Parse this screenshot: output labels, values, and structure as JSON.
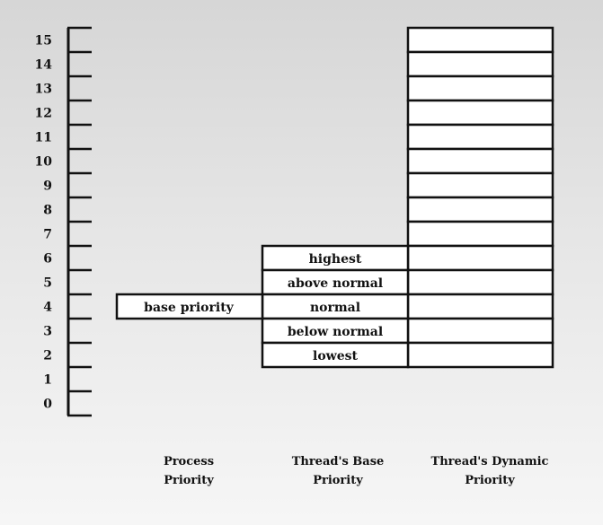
{
  "scale": {
    "levels": [
      "0",
      "1",
      "2",
      "3",
      "4",
      "5",
      "6",
      "7",
      "8",
      "9",
      "10",
      "11",
      "12",
      "13",
      "14",
      "15"
    ]
  },
  "process_priority": {
    "label": "base priority",
    "level": 4
  },
  "thread_base_priority": {
    "rows": [
      {
        "label": "highest",
        "level": 6
      },
      {
        "label": "above normal",
        "level": 5
      },
      {
        "label": "normal",
        "level": 4
      },
      {
        "label": "below normal",
        "level": 3
      },
      {
        "label": "lowest",
        "level": 2
      }
    ]
  },
  "thread_dynamic_priority": {
    "min_level": 2,
    "max_level": 15
  },
  "captions": [
    {
      "line1": "Process",
      "line2": "Priority"
    },
    {
      "line1": "Thread's Base",
      "line2": "Priority"
    },
    {
      "line1": "Thread's Dynamic",
      "line2": "Priority"
    }
  ]
}
